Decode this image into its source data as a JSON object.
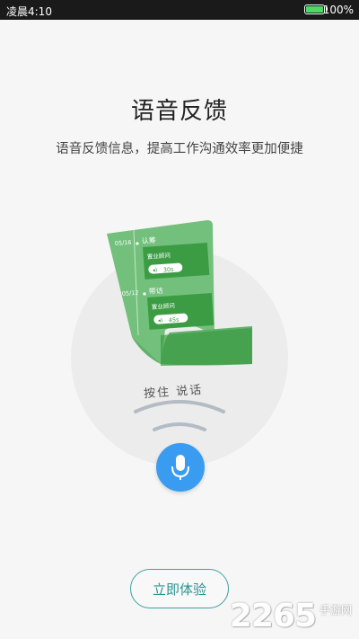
{
  "status_bar": {
    "time": "凌晨4:10",
    "battery": "100%"
  },
  "header": {
    "title": "语音反馈",
    "subtitle": "语音反馈信息，提高工作沟通效率更加便捷"
  },
  "illustration": {
    "entries": [
      {
        "date": "05/16",
        "type": "认筹",
        "role": "置业顾问",
        "duration": "30s"
      },
      {
        "date": "05/12",
        "type": "带访",
        "role": "置业顾问",
        "duration": "45s"
      }
    ]
  },
  "hint": "按住 说话",
  "icons": {
    "mic": "microphone-icon",
    "speaker": "speaker-icon"
  },
  "colors": {
    "accent": "#3a9cf0",
    "paper": "#72c07c",
    "paper_dark": "#3c9c44",
    "button": "#3aa3a0"
  },
  "actions": {
    "try": "立即体验"
  },
  "watermark": {
    "brand": "2265",
    "site": "手游网"
  }
}
